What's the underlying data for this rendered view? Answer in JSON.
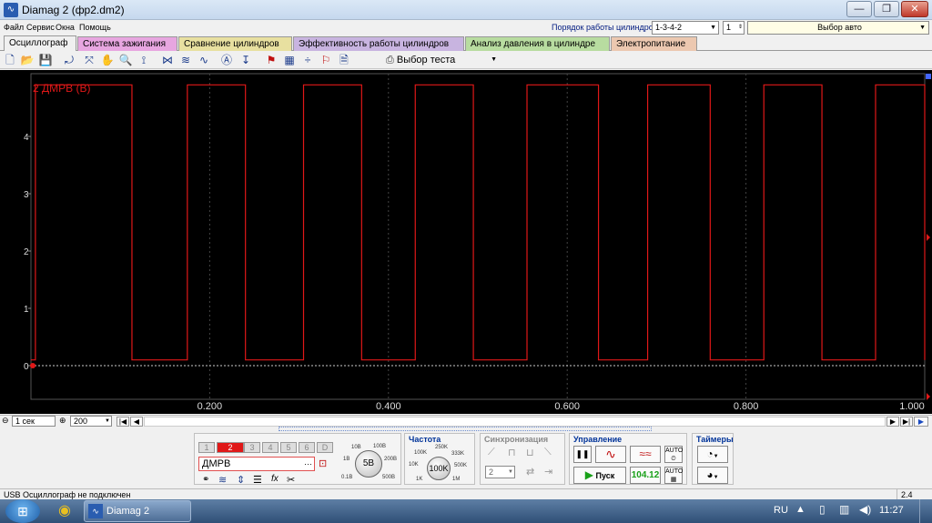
{
  "window": {
    "title": "Diamag 2 (фр2.dm2)",
    "minimize": "—",
    "maximize": "❐",
    "close": "✕"
  },
  "menu": [
    "Файл",
    "Сервис",
    "Окна",
    "Помощь"
  ],
  "cylinder_order": {
    "label": "Порядок работы цилиндров",
    "value": "1-3-4-2",
    "cyl": "1",
    "auto": "Выбор авто"
  },
  "tabs": [
    {
      "label": "Осциллограф",
      "color": "#f0f0f0"
    },
    {
      "label": "Система зажигания",
      "color": "#e7a6e0"
    },
    {
      "label": "Сравнение цилиндров",
      "color": "#e8e0a0"
    },
    {
      "label": "Эффективность работы цилиндров",
      "color": "#c8b4e0"
    },
    {
      "label": "Анализ давления в цилиндре",
      "color": "#b8dca0"
    },
    {
      "label": "Электропитание",
      "color": "#ecc8b0"
    }
  ],
  "toolbar": {
    "test_select": "Выбор теста"
  },
  "plot": {
    "channel_label": "2 ДМРВ (В)",
    "trace_color": "#e01818",
    "y_ticks": [
      "4",
      "3",
      "2",
      "1",
      "0"
    ],
    "x_ticks": [
      "0.200",
      "0.400",
      "0.600",
      "0.800",
      "1.000"
    ]
  },
  "timebase": {
    "time": "1 сек",
    "zoom": "200"
  },
  "channels": [
    "1",
    "2",
    "3",
    "4",
    "5",
    "6",
    "D"
  ],
  "sensor": {
    "name": "ДМРВ",
    "knob": "5В",
    "knob_ticks": [
      "10В",
      "100В",
      "1В",
      "200В",
      "0.1В",
      "500В"
    ]
  },
  "frequency": {
    "title": "Частота",
    "knob": "100K",
    "knob_ticks": [
      "250K",
      "100K",
      "333K",
      "10K",
      "500K",
      "1K",
      "1M"
    ]
  },
  "sync": {
    "title": "Синхронизация",
    "channel": "2"
  },
  "control": {
    "title": "Управление",
    "start": "Пуск",
    "value": "104.12"
  },
  "timers": {
    "title": "Таймеры"
  },
  "status": {
    "text": "USB Осциллограф не подключен",
    "right": "2.4"
  },
  "taskbar": {
    "app": "Diamag 2",
    "lang": "RU",
    "time": "11:27"
  }
}
